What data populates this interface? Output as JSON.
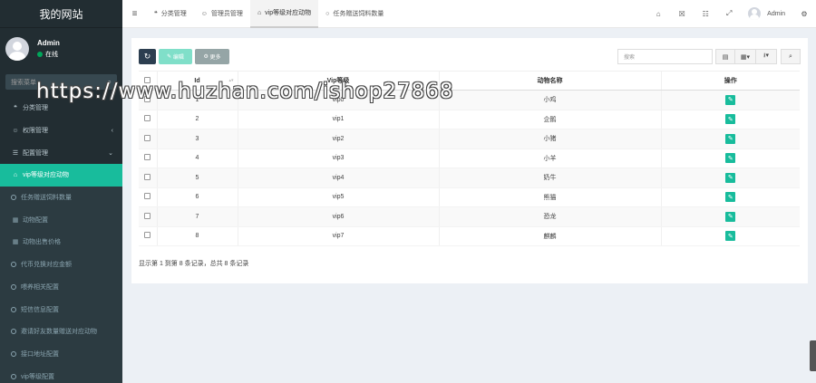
{
  "brand": {
    "title": "我的网站"
  },
  "user": {
    "name": "Admin",
    "status": "在线"
  },
  "sidebar": {
    "search_placeholder": "搜索菜单",
    "items": [
      {
        "label": "分类管理",
        "icon": "leaf-icon"
      },
      {
        "label": "权限管理",
        "icon": "users-icon"
      },
      {
        "label": "配置管理",
        "icon": "list-icon"
      },
      {
        "label": "vip等级对应动物",
        "icon": "home-icon"
      },
      {
        "label": "任务赠送饲料数量",
        "icon": "circle-icon"
      },
      {
        "label": "动物配置",
        "icon": "table-icon"
      },
      {
        "label": "动物出售价格",
        "icon": "table-icon"
      },
      {
        "label": "代币兑换对应金额",
        "icon": "circle-icon"
      },
      {
        "label": "喂养相关配置",
        "icon": "circle-icon"
      },
      {
        "label": "短信信息配置",
        "icon": "circle-icon"
      },
      {
        "label": "邀请好友数量赠送对应动物",
        "icon": "circle-icon"
      },
      {
        "label": "接口地址配置",
        "icon": "circle-icon"
      },
      {
        "label": "vip等级配置",
        "icon": "circle-icon"
      }
    ]
  },
  "header": {
    "tabs": [
      {
        "label": "分类管理",
        "icon": "leaf-icon"
      },
      {
        "label": "管理员管理",
        "icon": "user-icon"
      },
      {
        "label": "vip等级对应动物",
        "icon": "home-icon"
      },
      {
        "label": "任务赠送饲料数量",
        "icon": "circle-icon"
      }
    ],
    "user_name": "Admin"
  },
  "toolbar": {
    "refresh_label": "",
    "edit_label": "编辑",
    "more_label": "更多",
    "search_placeholder": "搜索"
  },
  "table": {
    "columns": [
      "Id",
      "Vip等级",
      "动物名称",
      "操作"
    ],
    "rows": [
      {
        "id": "1",
        "vip": "vip0",
        "animal": "小鸡"
      },
      {
        "id": "2",
        "vip": "vip1",
        "animal": "企鹅"
      },
      {
        "id": "3",
        "vip": "vip2",
        "animal": "小猪"
      },
      {
        "id": "4",
        "vip": "vip3",
        "animal": "小羊"
      },
      {
        "id": "5",
        "vip": "vip4",
        "animal": "奶牛"
      },
      {
        "id": "6",
        "vip": "vip5",
        "animal": "熊猫"
      },
      {
        "id": "7",
        "vip": "vip6",
        "animal": "恐龙"
      },
      {
        "id": "8",
        "vip": "vip7",
        "animal": "麒麟"
      }
    ]
  },
  "pagination": {
    "summary": "显示第 1 到第 8 条记录，总共 8 条记录"
  },
  "watermark": {
    "text": "https://www.huzhan.com/ishop27868"
  },
  "colors": {
    "accent": "#18bc9c",
    "sidebar": "#222d32",
    "dark_button": "#2c3e50"
  }
}
